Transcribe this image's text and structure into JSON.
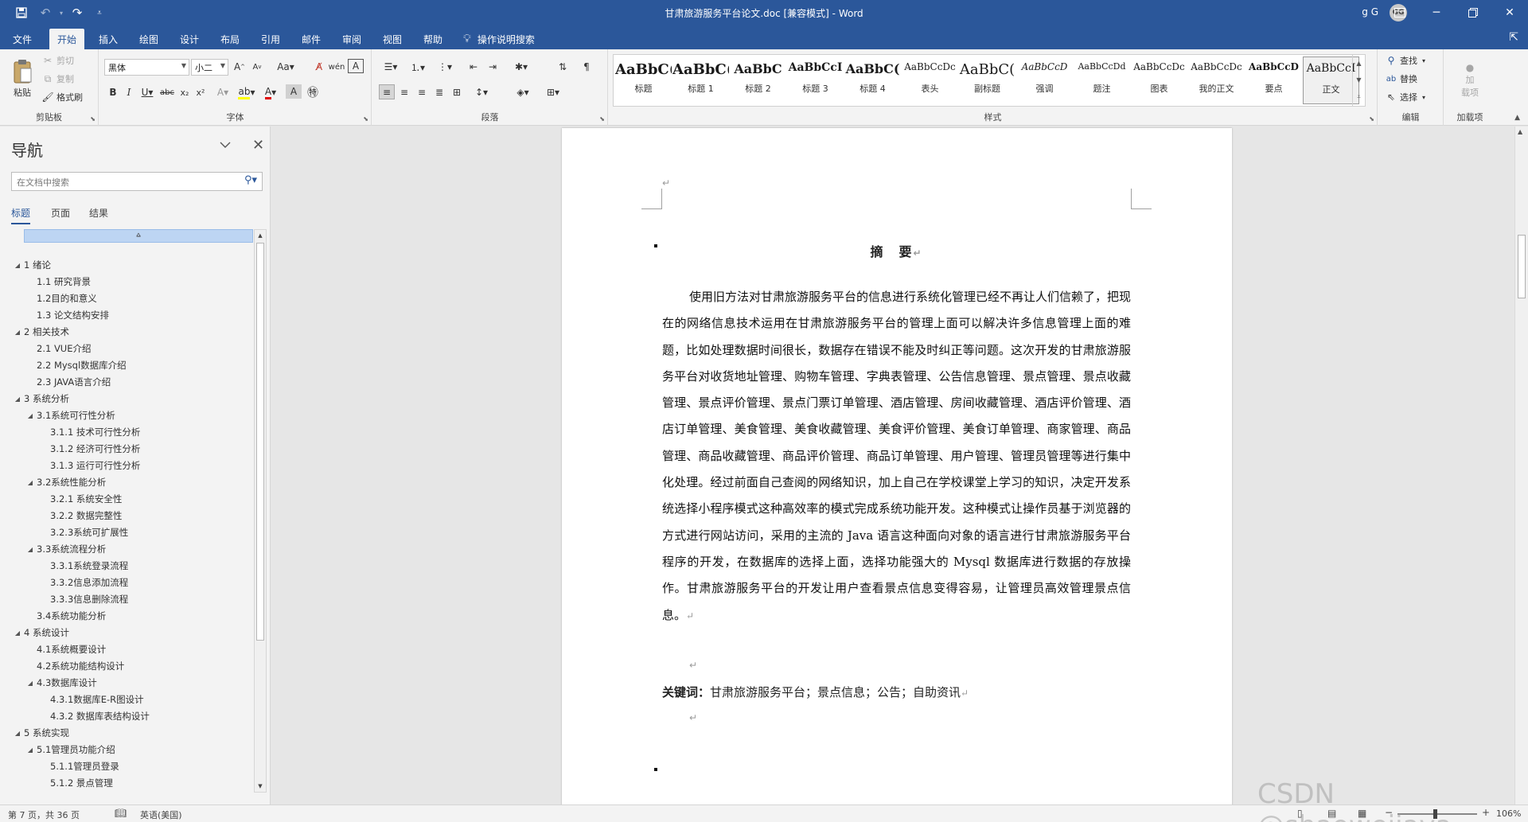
{
  "titlebar": {
    "title": "甘肃旅游服务平台论文.doc [兼容模式]  -  Word",
    "user_name": "g G",
    "user_initials": "GG",
    "qa_save_icon": "save-icon",
    "qa_undo_icon": "undo-icon",
    "qa_redo_icon": "redo-icon",
    "qa_customize_icon": "customize-icon"
  },
  "tabs": [
    {
      "label": "文件"
    },
    {
      "label": "开始"
    },
    {
      "label": "插入"
    },
    {
      "label": "绘图"
    },
    {
      "label": "设计"
    },
    {
      "label": "布局"
    },
    {
      "label": "引用"
    },
    {
      "label": "邮件"
    },
    {
      "label": "审阅"
    },
    {
      "label": "视图"
    },
    {
      "label": "帮助"
    }
  ],
  "tell_me": "操作说明搜索",
  "clipboard": {
    "paste": "粘贴",
    "cut": "剪切",
    "copy": "复制",
    "format_painter": "格式刷",
    "label": "剪贴板"
  },
  "font": {
    "family": "黑体",
    "size": "小二",
    "label": "字体"
  },
  "paragraph": {
    "label": "段落"
  },
  "styles": {
    "label": "样式",
    "items": [
      {
        "sample": "AaBbC(",
        "name": "标题"
      },
      {
        "sample": "AaBbC(",
        "name": "标题 1"
      },
      {
        "sample": "AaBbC",
        "name": "标题 2"
      },
      {
        "sample": "AaBbCcI",
        "name": "标题 3"
      },
      {
        "sample": "AaBbC(",
        "name": "标题 4"
      },
      {
        "sample": "AaBbCcDc",
        "name": "表头"
      },
      {
        "sample": "AaBbC(",
        "name": "副标题"
      },
      {
        "sample": "AaBbCcD",
        "name": "强调"
      },
      {
        "sample": "AaBbCcDd",
        "name": "题注"
      },
      {
        "sample": "AaBbCcDc",
        "name": "图表"
      },
      {
        "sample": "AaBbCcDc",
        "name": "我的正文"
      },
      {
        "sample": "AaBbCcD",
        "name": "要点"
      },
      {
        "sample": "AaBbCcI",
        "name": "正文"
      }
    ]
  },
  "editing": {
    "find": "查找",
    "replace": "替换",
    "select": "选择",
    "label": "编辑"
  },
  "addins": {
    "add": "加\n载项",
    "label": "加载项"
  },
  "nav": {
    "title": "导航",
    "search_placeholder": "在文档中搜索",
    "tabs": [
      "标题",
      "页面",
      "结果"
    ],
    "items": [
      {
        "text": "1 绪论",
        "level": 1,
        "expanded": true
      },
      {
        "text": "1.1 研究背景",
        "level": 2
      },
      {
        "text": "1.2目的和意义",
        "level": 2
      },
      {
        "text": "1.3 论文结构安排",
        "level": 2
      },
      {
        "text": "2 相关技术",
        "level": 1,
        "expanded": true
      },
      {
        "text": "2.1 VUE介绍",
        "level": 2
      },
      {
        "text": "2.2 Mysql数据库介绍",
        "level": 2
      },
      {
        "text": "2.3 JAVA语言介绍",
        "level": 2
      },
      {
        "text": "3 系统分析",
        "level": 1,
        "expanded": true
      },
      {
        "text": "3.1系统可行性分析",
        "level": 2,
        "expanded": true
      },
      {
        "text": "3.1.1 技术可行性分析",
        "level": 3
      },
      {
        "text": "3.1.2 经济可行性分析",
        "level": 3
      },
      {
        "text": "3.1.3 运行可行性分析",
        "level": 3
      },
      {
        "text": "3.2系统性能分析",
        "level": 2,
        "expanded": true
      },
      {
        "text": "3.2.1 系统安全性",
        "level": 3
      },
      {
        "text": "3.2.2 数据完整性",
        "level": 3
      },
      {
        "text": "3.2.3系统可扩展性",
        "level": 3
      },
      {
        "text": "3.3系统流程分析",
        "level": 2,
        "expanded": true
      },
      {
        "text": "3.3.1系统登录流程",
        "level": 3
      },
      {
        "text": "3.3.2信息添加流程",
        "level": 3
      },
      {
        "text": "3.3.3信息删除流程",
        "level": 3
      },
      {
        "text": "3.4系统功能分析",
        "level": 2
      },
      {
        "text": "4 系统设计",
        "level": 1,
        "expanded": true
      },
      {
        "text": "4.1系统概要设计",
        "level": 2
      },
      {
        "text": "4.2系统功能结构设计",
        "level": 2
      },
      {
        "text": "4.3数据库设计",
        "level": 2,
        "expanded": true
      },
      {
        "text": "4.3.1数据库E-R图设计",
        "level": 3
      },
      {
        "text": "4.3.2 数据库表结构设计",
        "level": 3
      },
      {
        "text": "5 系统实现",
        "level": 1,
        "expanded": true
      },
      {
        "text": "5.1管理员功能介绍",
        "level": 2,
        "expanded": true
      },
      {
        "text": "5.1.1管理员登录",
        "level": 3
      },
      {
        "text": "5.1.2 景点管理",
        "level": 3
      }
    ]
  },
  "document": {
    "abstract_title": "摘　要",
    "abstract_body": "使用旧方法对甘肃旅游服务平台的信息进行系统化管理已经不再让人们信赖了，把现在的网络信息技术运用在甘肃旅游服务平台的管理上面可以解决许多信息管理上面的难题，比如处理数据时间很长，数据存在错误不能及时纠正等问题。这次开发的甘肃旅游服务平台对收货地址管理、购物车管理、字典表管理、公告信息管理、景点管理、景点收藏管理、景点评价管理、景点门票订单管理、酒店管理、房间收藏管理、酒店评价管理、酒店订单管理、美食管理、美食收藏管理、美食评价管理、美食订单管理、商家管理、商品管理、商品收藏管理、商品评价管理、商品订单管理、用户管理、管理员管理等进行集中化处理。经过前面自己查阅的网络知识，加上自己在学校课堂上学习的知识，决定开发系统选择小程序模式这种高效率的模式完成系统功能开发。这种模式让操作员基于浏览器的方式进行网站访问，采用的主流的 Java 语言这种面向对象的语言进行甘肃旅游服务平台程序的开发，在数据库的选择上面，选择功能强大的 Mysql 数据库进行数据的存放操作。甘肃旅游服务平台的开发让用户查看景点信息变得容易，让管理员高效管理景点信息。",
    "keywords_label": "关键词：",
    "keywords_text": "甘肃旅游服务平台；景点信息；公告；自助资讯",
    "pilcrow": "↵"
  },
  "status": {
    "page_info": "第 7 页，共 36 页",
    "language": "英语(美国)",
    "zoom": "106%"
  },
  "watermark": "CSDN @shaoweijava",
  "colors": {
    "accent": "#2b579a",
    "ribbon_bg": "#f3f3f3",
    "doc_bg": "#e6e6e6"
  }
}
